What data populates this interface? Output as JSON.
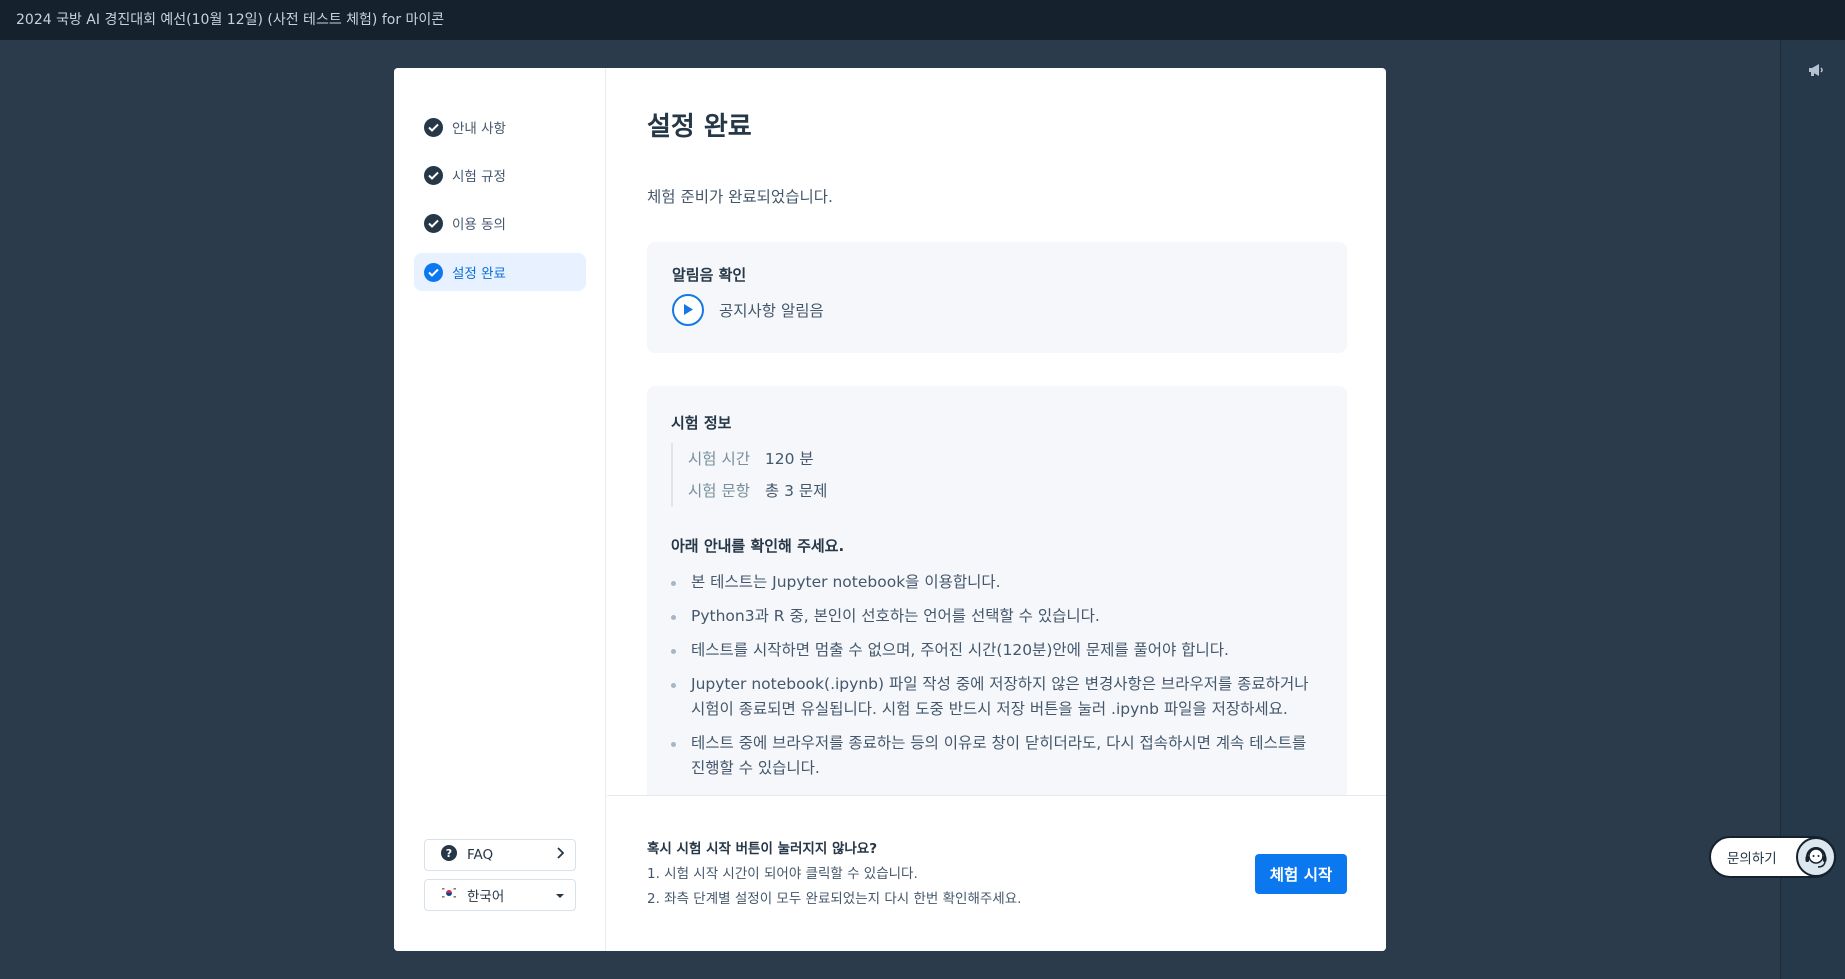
{
  "window": {
    "title": "2024 국방 AI 경진대회 예선(10월 12일) (사전 테스트 체험) for 마이콘"
  },
  "sidebar": {
    "steps": [
      {
        "label": "안내 사항",
        "done": true
      },
      {
        "label": "시험 규정",
        "done": true
      },
      {
        "label": "이용 동의",
        "done": true
      },
      {
        "label": "설정 완료",
        "done": true,
        "active": true
      }
    ],
    "faq_label": "FAQ",
    "language_label": "한국어"
  },
  "main": {
    "title": "설정 완료",
    "intro": "체험 준비가 완료되었습니다.",
    "sound_card": {
      "title": "알림음 확인",
      "play_label": "공지사항 알림음"
    },
    "exam_info": {
      "title": "시험 정보",
      "rows": [
        {
          "key": "시험 시간",
          "value": "120 분"
        },
        {
          "key": "시험 문항",
          "value": "총 3 문제"
        }
      ],
      "notice_title": "아래 안내를 확인해 주세요.",
      "notices": [
        "본 테스트는 Jupyter notebook을 이용합니다.",
        "Python3과 R 중, 본인이 선호하는 언어를 선택할 수 있습니다.",
        "테스트를 시작하면 멈출 수 없으며, 주어진 시간(120분)안에 문제를 풀어야 합니다.",
        "Jupyter notebook(.ipynb) 파일 작성 중에 저장하지 않은 변경사항은 브라우저를 종료하거나 시험이 종료되면 유실됩니다. 시험 도중 반드시 저장 버튼을 눌러 .ipynb 파일을 저장하세요.",
        "테스트 중에 브라우저를 종료하는 등의 이유로 창이 닫히더라도, 다시 접속하시면 계속 테스트를 진행할 수 있습니다."
      ]
    }
  },
  "footer": {
    "question": "혹시 시험 시작 버튼이 눌러지지 않나요?",
    "line1": "1. 시험 시작 시간이 되어야 클릭할 수 있습니다.",
    "line2": "2. 좌측 단계별 설정이 모두 완료되었는지 다시 한번 확인해주세요.",
    "start_button": "체험 시작"
  },
  "inquiry": {
    "label": "문의하기"
  },
  "colors": {
    "accent": "#0c78f0",
    "topbar": "#15212c",
    "background": "#2b3b4c"
  }
}
